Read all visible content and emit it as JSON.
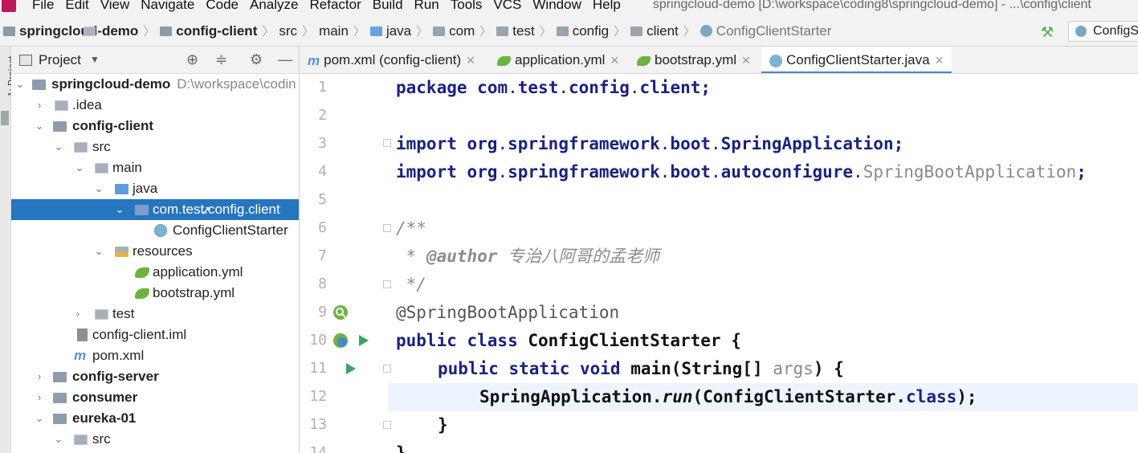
{
  "menu": {
    "items": [
      "File",
      "Edit",
      "View",
      "Navigate",
      "Code",
      "Analyze",
      "Refactor",
      "Build",
      "Run",
      "Tools",
      "VCS",
      "Window",
      "Help"
    ],
    "window_title": "springcloud-demo [D:\\workspace\\coding8\\springcloud-demo] - ...\\config\\client"
  },
  "breadcrumbs": [
    "springcloud-demo",
    "config-client",
    "src",
    "main",
    "java",
    "com",
    "test",
    "config",
    "client",
    "ConfigClientStarter"
  ],
  "run_config": "ConfigS",
  "project_panel": {
    "title": "Project"
  },
  "side_strip_label": "1: Project",
  "tree": [
    {
      "label": "springcloud-demo",
      "extra": "D:\\workspace\\codin",
      "icon": "module",
      "expanded": true,
      "bold": true
    },
    {
      "label": ".idea",
      "icon": "folder",
      "expanded": false
    },
    {
      "label": "config-client",
      "icon": "module",
      "expanded": true,
      "bold": true
    },
    {
      "label": "src",
      "icon": "folder",
      "expanded": true
    },
    {
      "label": "main",
      "icon": "folder",
      "expanded": true
    },
    {
      "label": "java",
      "icon": "source-folder",
      "expanded": true
    },
    {
      "label": "com.test.config.client",
      "icon": "package",
      "expanded": true,
      "selected": true
    },
    {
      "label": "ConfigClientStarter",
      "icon": "class"
    },
    {
      "label": "resources",
      "icon": "resources",
      "expanded": true
    },
    {
      "label": "application.yml",
      "icon": "yml"
    },
    {
      "label": "bootstrap.yml",
      "icon": "yml"
    },
    {
      "label": "test",
      "icon": "folder",
      "expanded": false
    },
    {
      "label": "config-client.iml",
      "icon": "iml"
    },
    {
      "label": "pom.xml",
      "icon": "pom"
    },
    {
      "label": "config-server",
      "icon": "module",
      "expanded": false,
      "bold": true
    },
    {
      "label": "consumer",
      "icon": "module",
      "expanded": false,
      "bold": true
    },
    {
      "label": "eureka-01",
      "icon": "module",
      "expanded": true,
      "bold": true
    },
    {
      "label": "src",
      "icon": "folder",
      "expanded": true
    }
  ],
  "tabs": [
    {
      "label": "pom.xml (config-client)",
      "icon": "pom"
    },
    {
      "label": "application.yml",
      "icon": "yml"
    },
    {
      "label": "bootstrap.yml",
      "icon": "yml"
    },
    {
      "label": "ConfigClientStarter.java",
      "icon": "class",
      "active": true
    }
  ],
  "editor": {
    "line_numbers": [
      "1",
      "2",
      "3",
      "4",
      "5",
      "6",
      "7",
      "8",
      "9",
      "10",
      "11",
      "12",
      "13",
      "14"
    ],
    "current_line": "12",
    "code": {
      "l1_kw": "package",
      "l1_a": "com",
      "l1_b": "test",
      "l1_c": "config",
      "l1_d": "client",
      "l3_kw": "import",
      "l3_a": "org",
      "l3_b": "springframework",
      "l3_c": "boot",
      "l3_d": "SpringApplication",
      "l4_kw": "import",
      "l4_a": "org",
      "l4_b": "springframework",
      "l4_c": "boot",
      "l4_d": "autoconfigure",
      "l4_e": "SpringBootApplication",
      "l6": "/**",
      "l7_star": " * ",
      "l7_tag": "@author",
      "l7_text": " 专治八阿哥的孟老师",
      "l8": " */",
      "l9": "@SpringBootApplication",
      "l10_kw": "public class",
      "l10_name": " ConfigClientStarter {",
      "l11_kw": "public static void",
      "l11_a": " main(String[] ",
      "l11_param": "args",
      "l11_b": ") {",
      "l12_a": "SpringApplication.",
      "l12_run": "run",
      "l12_b": "(ConfigClientStarter.",
      "l12_kw": "class",
      "l12_c": ");",
      "l13": "}",
      "l14": "}"
    }
  }
}
